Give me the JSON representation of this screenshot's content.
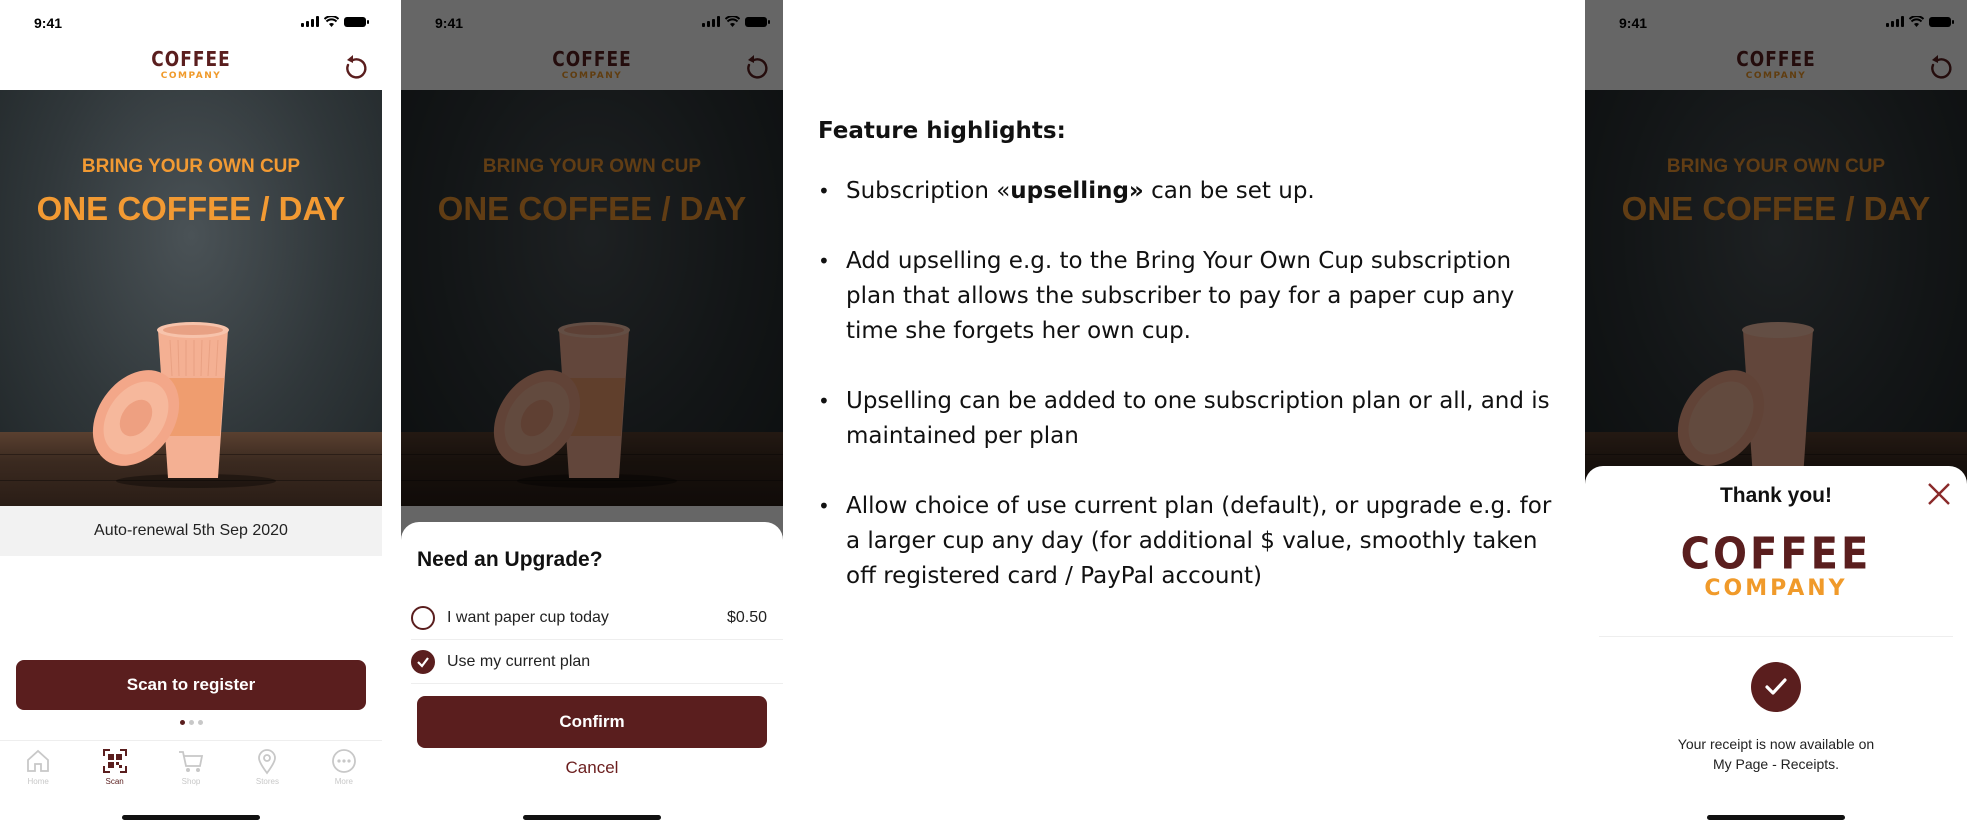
{
  "status_time": "9:41",
  "brand": {
    "line1": "COFFEE",
    "line2": "COMPANY"
  },
  "hero": {
    "tagline": "BRING YOUR OWN CUP",
    "headline": "ONE COFFEE / DAY"
  },
  "screen1": {
    "renewal": "Auto-renewal 5th Sep 2020",
    "primary_button": "Scan to register",
    "page_dots": {
      "count": 3,
      "active": 1
    },
    "tabs": [
      {
        "label": "Home",
        "icon": "home-icon",
        "active": false
      },
      {
        "label": "Scan",
        "icon": "qr-scan-icon",
        "active": true
      },
      {
        "label": "Shop",
        "icon": "cart-icon",
        "active": false
      },
      {
        "label": "Stores",
        "icon": "location-pin-icon",
        "active": false
      },
      {
        "label": "More",
        "icon": "more-icon",
        "active": false
      }
    ]
  },
  "screen2": {
    "sheet_title": "Need an Upgrade?",
    "options": [
      {
        "label": "I want paper cup today",
        "price": "$0.50",
        "checked": false
      },
      {
        "label": "Use my current plan",
        "price": "",
        "checked": true
      }
    ],
    "confirm": "Confirm",
    "cancel": "Cancel"
  },
  "screen3": {
    "title": "Thank you!",
    "receipt_line1": "Your receipt is now available on",
    "receipt_line2": "My Page - Receipts."
  },
  "slide": {
    "heading": "Feature highlights:",
    "bullet1_pre": "Subscription «",
    "bullet1_bold": "upselling»",
    "bullet1_post": " can be set up.",
    "bullet2": "Add upselling e.g. to the Bring Your Own Cup subscription plan that allows the subscriber to pay for a paper cup any time she forgets her own cup.",
    "bullet3": "Upselling can be added to one subscription plan or all, and is maintained per plan",
    "bullet4": "Allow choice of use current plan (default), or upgrade e.g. for a larger cup any day (for additional $ value, smoothly taken off registered card / PayPal account)"
  },
  "colors": {
    "brand_maroon": "#5a1e1e",
    "accent_orange": "#f29a33",
    "cup_peach": "#f3a789"
  }
}
